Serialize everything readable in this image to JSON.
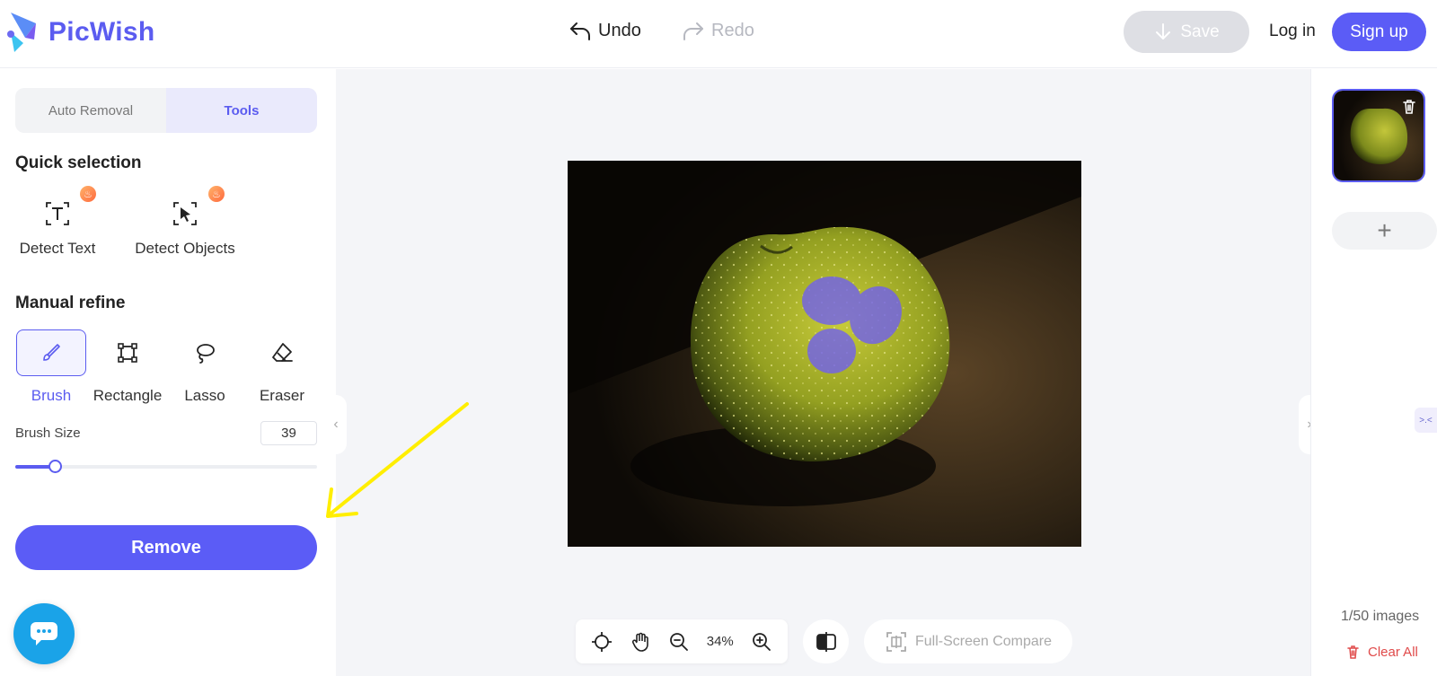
{
  "header": {
    "logo_text": "PicWish",
    "undo_label": "Undo",
    "redo_label": "Redo",
    "save_label": "Save",
    "login_label": "Log in",
    "signup_label": "Sign up"
  },
  "left_panel": {
    "tabs": [
      {
        "label": "Auto Removal",
        "active": false
      },
      {
        "label": "Tools",
        "active": true
      }
    ],
    "quick_selection": {
      "title": "Quick selection",
      "items": [
        {
          "label": "Detect Text",
          "icon": "detect-text-icon",
          "badge": "hot-icon"
        },
        {
          "label": "Detect Objects",
          "icon": "detect-objects-icon",
          "badge": "hot-icon"
        }
      ]
    },
    "manual_refine": {
      "title": "Manual refine",
      "tools": [
        {
          "label": "Brush",
          "icon": "brush-icon",
          "active": true
        },
        {
          "label": "Rectangle",
          "icon": "rectangle-icon",
          "active": false
        },
        {
          "label": "Lasso",
          "icon": "lasso-icon",
          "active": false
        },
        {
          "label": "Eraser",
          "icon": "eraser-icon",
          "active": false
        }
      ]
    },
    "brush_size": {
      "label": "Brush Size",
      "value": "39",
      "slider_fraction": 0.13
    },
    "remove_label": "Remove"
  },
  "canvas": {
    "zoom_level": "34%",
    "fullscreen_compare_label": "Full-Screen Compare"
  },
  "right_panel": {
    "image_count": "1/50 images",
    "clear_all_label": "Clear All",
    "add_label": "+"
  },
  "colors": {
    "accent": "#5b5cf6",
    "danger": "#e04a4a",
    "annotation": "#ffee00",
    "chat": "#1aa3e8"
  }
}
